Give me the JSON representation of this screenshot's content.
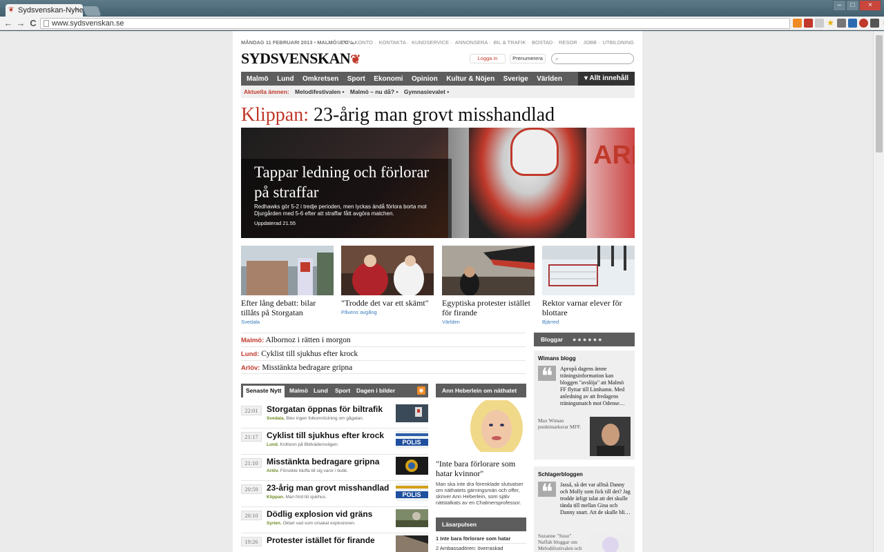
{
  "browser": {
    "tab_title": "Sydsvenskan-Nyhete",
    "tab_close": "×",
    "url": "www.sydsvenskan.se",
    "window_controls": [
      "–",
      "□",
      "×"
    ]
  },
  "topbar": {
    "date": "MÅNDAG 11 FEBRUARI 2013",
    "separator": "•",
    "weather": "MALMÖ -3°C",
    "links": [
      "SKAPA KONTO",
      "KONTAKTA",
      "KUNDSERVICE",
      "ANNONSERA",
      "BIL & TRAFIK",
      "BOSTAD",
      "RESOR",
      "JOBB",
      "UTBILDNING"
    ]
  },
  "logo": {
    "text": "SYDSVENSKAN",
    "mark": "❦"
  },
  "header": {
    "login": "Logga in",
    "subscribe": "Prenumerera"
  },
  "nav": {
    "items": [
      "Malmö",
      "Lund",
      "Omkretsen",
      "Sport",
      "Ekonomi",
      "Opinion",
      "Kultur & Nöjen",
      "Sverige",
      "Världen"
    ],
    "all_content": "▾ Allt innehåll"
  },
  "topics": {
    "label": "Aktuella ämnen:",
    "items": [
      "Melodifestivalen •",
      "Malmö – nu då? •",
      "Gymnasievalet •"
    ]
  },
  "headline": {
    "place": "Klippan:",
    "text": "23-årig man grovt misshandlad"
  },
  "hero": {
    "title": "Tappar ledning och förlorar på straffar",
    "text": "Redhawks gör 5-2 i tredje perioden, men lyckas ändå förlora borta mot Djurgården med 5-6 efter att straffar fått avgöra matchen.",
    "updated": "Uppdaterad 21.55",
    "brand": "ARI"
  },
  "cards": [
    {
      "title": "Efter lång debatt: bilar tillåts på Storgatan",
      "cat": "Svedala"
    },
    {
      "title": "\"Trodde det var ett skämt\"",
      "cat": "Påvens avgång"
    },
    {
      "title": "Egyptiska protester istället för firande",
      "cat": "Världen"
    },
    {
      "title": "Rektor varnar elever för blottare",
      "cat": "Bjärred"
    }
  ],
  "links": [
    {
      "place": "Malmö:",
      "text": "Albornoz i rätten i morgon"
    },
    {
      "place": "Lund:",
      "text": "Cyklist till sjukhus efter krock"
    },
    {
      "place": "Arlöv:",
      "text": "Misstänkta bedragare gripna"
    }
  ],
  "news_tabs": [
    "Senaste Nytt",
    "Malmö",
    "Lund",
    "Sport",
    "Dagen i bilder"
  ],
  "news": [
    {
      "time": "22:01",
      "title": "Storgatan öppnas för biltrafik",
      "place": "Svedala.",
      "sub": "Blev ingen folkomröstning om gågatan."
    },
    {
      "time": "21:17",
      "title": "Cyklist till sjukhus efter krock",
      "place": "Lund.",
      "sub": "Kollision på Blidvädersvägen."
    },
    {
      "time": "21:10",
      "title": "Misstänkta bedragare gripna",
      "place": "Arlöv.",
      "sub": "Försökte bluffa till sig varor i butik."
    },
    {
      "time": "20:59",
      "title": "23-årig man grovt misshandlad",
      "place": "Klippan.",
      "sub": "Man förd till sjukhus."
    },
    {
      "time": "20:10",
      "title": "Dödlig explosion vid gräns",
      "place": "Syrien.",
      "sub": "Oklart vad som orsakat explosionen."
    },
    {
      "time": "19:26",
      "title": "Protester istället för firande",
      "place": "",
      "sub": ""
    }
  ],
  "opinion": {
    "header": "Ann Heberlein om näthatet",
    "quote": "\"Inte bara förlorare som hatar kvinnor\"",
    "text": "Man ska inte dra förenklade slutsatser om näthatets gärningsmän och offer, skriver Ann Heberlein, som själv nätstalkats av en Chalmersprofessor."
  },
  "lasarpulsen": {
    "header": "Läsarpulsen",
    "items": [
      "1 Inte bara förlorare som hatar",
      "2 Ambassadören: överraskad"
    ]
  },
  "bloggar": {
    "header": "Bloggar",
    "dots": "●●●●●●"
  },
  "blogs": [
    {
      "name": "Wimans blogg",
      "text": "Apropå dagens ämne träningsinformation kan bloggen \"avslöja\" att Malmö FF flyttar till Limhamn. Med anledning av att fredagens träningsmatch mot Odense…",
      "author": "Max Wiman punktmarkerar MFF."
    },
    {
      "name": "Schlagerbloggen",
      "text": "Jasså, så det var alltså Danny och Molly som fick till det? Jag trodde ärligt talat att det skulle tända till mellan Gina och Danny snart. Att de skulle bli…",
      "author": "Suzanne \"Suuz\" Naffah bloggar om Melodifestivalen och"
    }
  ],
  "colors": {
    "accent": "#c0392b",
    "nav": "#5d5d5d",
    "link_blue": "#3a7bbf",
    "place_green": "#6c8a1f"
  },
  "icons": {
    "back": "←",
    "forward": "→",
    "reload": "C",
    "quote": "❝",
    "search": "⌕",
    "rss": "◉"
  }
}
